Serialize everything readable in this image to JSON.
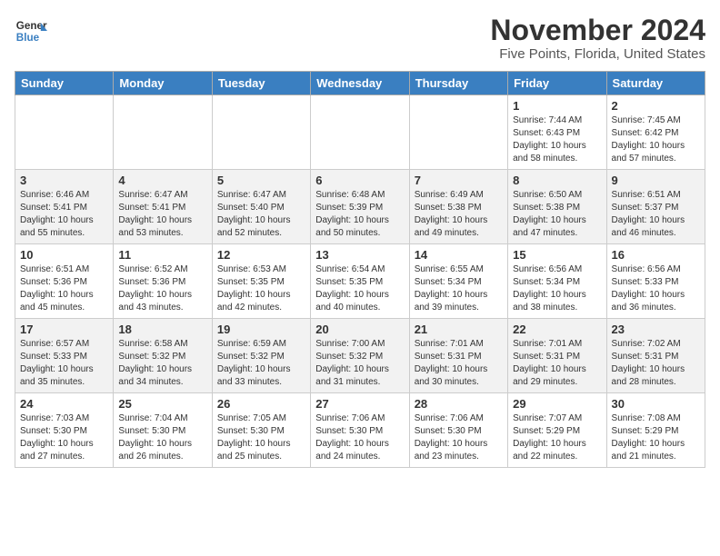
{
  "header": {
    "logo_line1": "General",
    "logo_line2": "Blue",
    "month": "November 2024",
    "location": "Five Points, Florida, United States"
  },
  "weekdays": [
    "Sunday",
    "Monday",
    "Tuesday",
    "Wednesday",
    "Thursday",
    "Friday",
    "Saturday"
  ],
  "weeks": [
    [
      {
        "day": "",
        "info": ""
      },
      {
        "day": "",
        "info": ""
      },
      {
        "day": "",
        "info": ""
      },
      {
        "day": "",
        "info": ""
      },
      {
        "day": "",
        "info": ""
      },
      {
        "day": "1",
        "info": "Sunrise: 7:44 AM\nSunset: 6:43 PM\nDaylight: 10 hours and 58 minutes."
      },
      {
        "day": "2",
        "info": "Sunrise: 7:45 AM\nSunset: 6:42 PM\nDaylight: 10 hours and 57 minutes."
      }
    ],
    [
      {
        "day": "3",
        "info": "Sunrise: 6:46 AM\nSunset: 5:41 PM\nDaylight: 10 hours and 55 minutes."
      },
      {
        "day": "4",
        "info": "Sunrise: 6:47 AM\nSunset: 5:41 PM\nDaylight: 10 hours and 53 minutes."
      },
      {
        "day": "5",
        "info": "Sunrise: 6:47 AM\nSunset: 5:40 PM\nDaylight: 10 hours and 52 minutes."
      },
      {
        "day": "6",
        "info": "Sunrise: 6:48 AM\nSunset: 5:39 PM\nDaylight: 10 hours and 50 minutes."
      },
      {
        "day": "7",
        "info": "Sunrise: 6:49 AM\nSunset: 5:38 PM\nDaylight: 10 hours and 49 minutes."
      },
      {
        "day": "8",
        "info": "Sunrise: 6:50 AM\nSunset: 5:38 PM\nDaylight: 10 hours and 47 minutes."
      },
      {
        "day": "9",
        "info": "Sunrise: 6:51 AM\nSunset: 5:37 PM\nDaylight: 10 hours and 46 minutes."
      }
    ],
    [
      {
        "day": "10",
        "info": "Sunrise: 6:51 AM\nSunset: 5:36 PM\nDaylight: 10 hours and 45 minutes."
      },
      {
        "day": "11",
        "info": "Sunrise: 6:52 AM\nSunset: 5:36 PM\nDaylight: 10 hours and 43 minutes."
      },
      {
        "day": "12",
        "info": "Sunrise: 6:53 AM\nSunset: 5:35 PM\nDaylight: 10 hours and 42 minutes."
      },
      {
        "day": "13",
        "info": "Sunrise: 6:54 AM\nSunset: 5:35 PM\nDaylight: 10 hours and 40 minutes."
      },
      {
        "day": "14",
        "info": "Sunrise: 6:55 AM\nSunset: 5:34 PM\nDaylight: 10 hours and 39 minutes."
      },
      {
        "day": "15",
        "info": "Sunrise: 6:56 AM\nSunset: 5:34 PM\nDaylight: 10 hours and 38 minutes."
      },
      {
        "day": "16",
        "info": "Sunrise: 6:56 AM\nSunset: 5:33 PM\nDaylight: 10 hours and 36 minutes."
      }
    ],
    [
      {
        "day": "17",
        "info": "Sunrise: 6:57 AM\nSunset: 5:33 PM\nDaylight: 10 hours and 35 minutes."
      },
      {
        "day": "18",
        "info": "Sunrise: 6:58 AM\nSunset: 5:32 PM\nDaylight: 10 hours and 34 minutes."
      },
      {
        "day": "19",
        "info": "Sunrise: 6:59 AM\nSunset: 5:32 PM\nDaylight: 10 hours and 33 minutes."
      },
      {
        "day": "20",
        "info": "Sunrise: 7:00 AM\nSunset: 5:32 PM\nDaylight: 10 hours and 31 minutes."
      },
      {
        "day": "21",
        "info": "Sunrise: 7:01 AM\nSunset: 5:31 PM\nDaylight: 10 hours and 30 minutes."
      },
      {
        "day": "22",
        "info": "Sunrise: 7:01 AM\nSunset: 5:31 PM\nDaylight: 10 hours and 29 minutes."
      },
      {
        "day": "23",
        "info": "Sunrise: 7:02 AM\nSunset: 5:31 PM\nDaylight: 10 hours and 28 minutes."
      }
    ],
    [
      {
        "day": "24",
        "info": "Sunrise: 7:03 AM\nSunset: 5:30 PM\nDaylight: 10 hours and 27 minutes."
      },
      {
        "day": "25",
        "info": "Sunrise: 7:04 AM\nSunset: 5:30 PM\nDaylight: 10 hours and 26 minutes."
      },
      {
        "day": "26",
        "info": "Sunrise: 7:05 AM\nSunset: 5:30 PM\nDaylight: 10 hours and 25 minutes."
      },
      {
        "day": "27",
        "info": "Sunrise: 7:06 AM\nSunset: 5:30 PM\nDaylight: 10 hours and 24 minutes."
      },
      {
        "day": "28",
        "info": "Sunrise: 7:06 AM\nSunset: 5:30 PM\nDaylight: 10 hours and 23 minutes."
      },
      {
        "day": "29",
        "info": "Sunrise: 7:07 AM\nSunset: 5:29 PM\nDaylight: 10 hours and 22 minutes."
      },
      {
        "day": "30",
        "info": "Sunrise: 7:08 AM\nSunset: 5:29 PM\nDaylight: 10 hours and 21 minutes."
      }
    ]
  ]
}
